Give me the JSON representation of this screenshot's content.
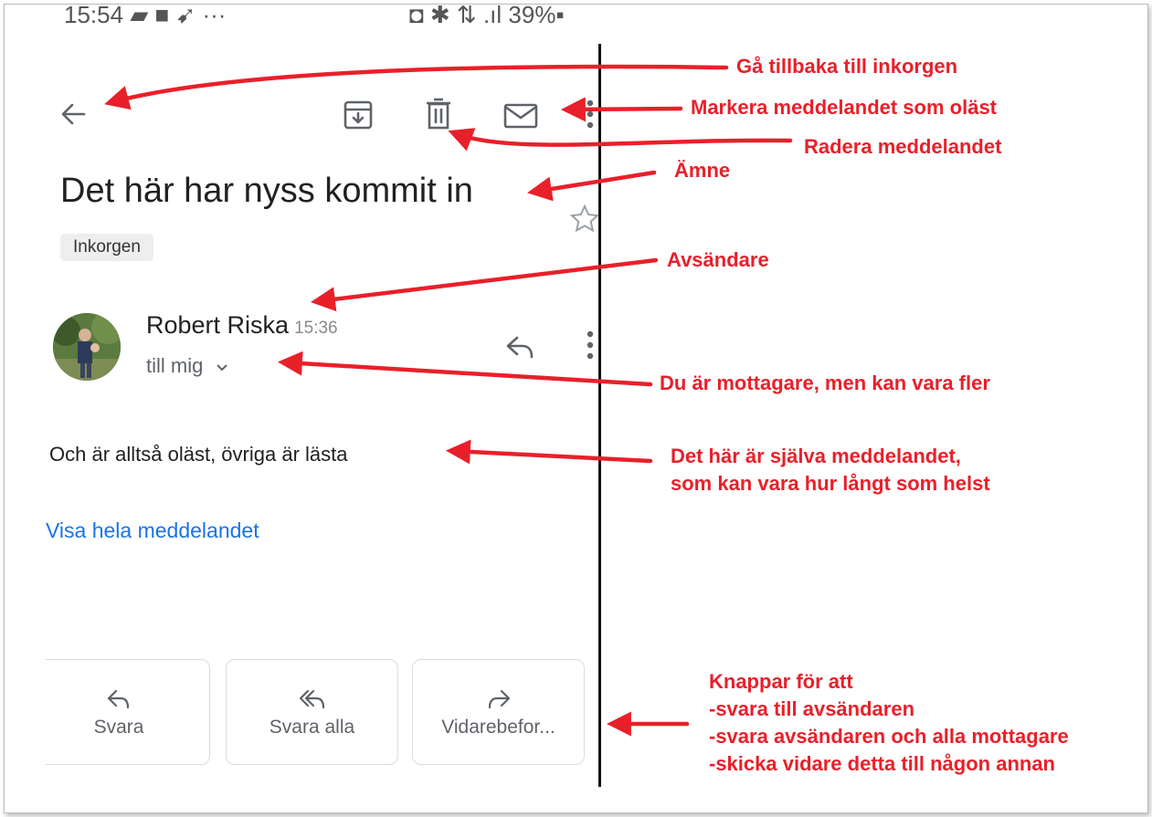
{
  "status_bar": {
    "time": "15:54",
    "left_icons": "▰ ■ ➹ ···",
    "right_text": "◘ ✱ ⇅ .ıl 39%▪"
  },
  "toolbar": {
    "back_icon": "arrow-left-icon",
    "archive_icon": "archive-icon",
    "delete_icon": "trash-icon",
    "mark_unread_icon": "mail-icon",
    "more_icon": "more-vert-icon"
  },
  "email": {
    "subject": "Det här har nyss kommit in",
    "label": "Inkorgen",
    "sender": "Robert Riska",
    "time": "15:36",
    "recipient": "till mig",
    "body": "Och är alltså oläst, övriga är lästa",
    "show_full_link": "Visa hela meddelandet"
  },
  "actions": [
    {
      "label": "Svara",
      "icon": "reply-icon"
    },
    {
      "label": "Svara alla",
      "icon": "reply-all-icon"
    },
    {
      "label": "Vidarebefor...",
      "icon": "forward-icon"
    }
  ],
  "annotations": {
    "back": "Gå tillbaka till inkorgen",
    "unread": "Markera meddelandet som oläst",
    "delete": "Radera meddelandet",
    "subject": "Ämne",
    "sender": "Avsändare",
    "recipient": "Du är mottagare, men kan vara fler",
    "body_line1": "Det här är själva meddelandet,",
    "body_line2": "som kan vara hur långt som helst",
    "buttons_line1": "Knappar för att",
    "buttons_line2": "-svara till avsändaren",
    "buttons_line3": "-svara avsändaren och alla mottagare",
    "buttons_line4": "-skicka vidare detta till någon annan"
  },
  "colors": {
    "annotation": "#e8202a",
    "link": "#1a73e8",
    "icon": "#5f6368",
    "text": "#202124"
  }
}
